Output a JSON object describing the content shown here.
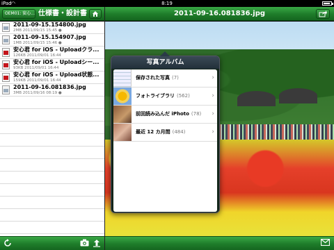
{
  "status_bar": {
    "carrier": "iPad",
    "time": "8:19",
    "battery_level": 0.9
  },
  "left_toolbar": {
    "back_label": "OEM01: 安心...",
    "title": "仕様書・設計書"
  },
  "right_toolbar": {
    "title": "2011-09-16.081836.jpg"
  },
  "files": [
    {
      "name": "2011-09-15.154800.jpg",
      "meta": "2MB  2011/09/15 15:45 ●",
      "type": "img"
    },
    {
      "name": "2011-09-15.154907.jpg",
      "meta": "1MB  2011/09/15 15:46 ●",
      "type": "img"
    },
    {
      "name": "安心君 for iOS - Uploadクラ...",
      "meta": "126KB  2011/09/01 16:44",
      "type": "pdf"
    },
    {
      "name": "安心君 for iOS - Uploadシー...",
      "meta": "93KB  2011/09/01 16:44",
      "type": "pdf"
    },
    {
      "name": "安心君 for iOS - Upload状態...",
      "meta": "159KB  2011/09/01 16:44",
      "type": "pdf"
    },
    {
      "name": "2011-09-16.081836.jpg",
      "meta": "3MB  2011/09/16 08:19 ●",
      "type": "img"
    }
  ],
  "popover": {
    "title": "写真アルバム",
    "albums": [
      {
        "label": "保存された写真",
        "count": "(7)",
        "thumb": "saved"
      },
      {
        "label": "フォトライブラリ",
        "count": "(562)",
        "thumb": "library"
      },
      {
        "label": "前回読み込んだ iPhoto",
        "count": "(78)",
        "thumb": "iphoto"
      },
      {
        "label": "最近 12 カ月間",
        "count": "(484)",
        "thumb": "recent"
      }
    ]
  },
  "colors": {
    "toolbar_green": "#1e7c2a",
    "popover_dark": "#22303a"
  },
  "icons": {
    "home": "home-icon",
    "share": "share-icon",
    "refresh": "refresh-icon",
    "camera": "camera-icon",
    "upload": "upload-icon",
    "mail": "mail-icon"
  }
}
